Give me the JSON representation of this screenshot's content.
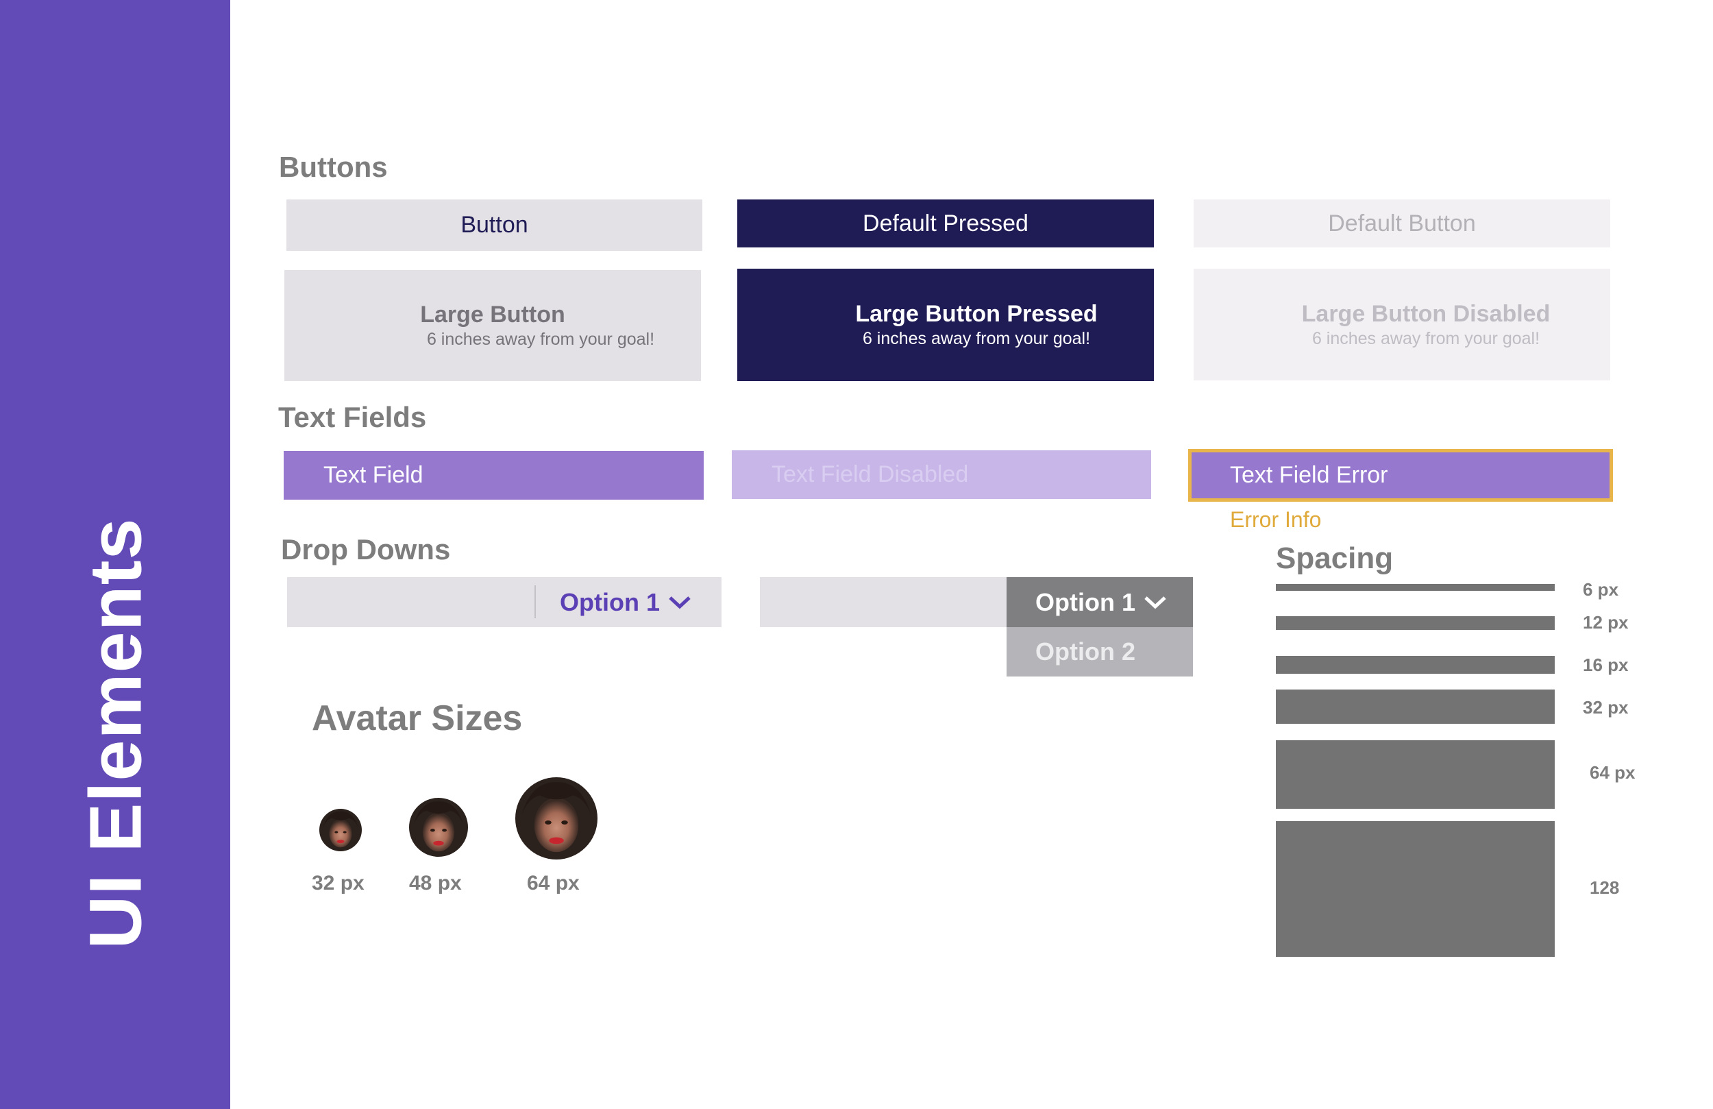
{
  "sidebar": {
    "title": "UI Elements",
    "color": "#624bb7"
  },
  "buttons": {
    "heading": "Buttons",
    "default": "Button",
    "pressed": "Default Pressed",
    "disabled": "Default Button",
    "large_default": {
      "title": "Large Button",
      "subtitle": "6 inches away from your goal!"
    },
    "large_pressed": {
      "title": "Large Button Pressed",
      "subtitle": "6 inches away from your goal!"
    },
    "large_disabled": {
      "title": "Large Button Disabled",
      "subtitle": "6 inches away from your goal!"
    }
  },
  "text_fields": {
    "heading": "Text Fields",
    "normal": "Text Field",
    "disabled": "Text Field Disabled",
    "error": "Text Field Error",
    "error_info": "Error Info"
  },
  "dropdowns": {
    "heading": "Drop Downs",
    "closed_selected": "Option 1",
    "open_selected": "Option 1",
    "open_options": [
      "Option 2"
    ]
  },
  "avatars": {
    "heading": "Avatar Sizes",
    "sizes": [
      "32 px",
      "48 px",
      "64 px"
    ]
  },
  "spacing": {
    "heading": "Spacing",
    "labels": [
      "6 px",
      "12 px",
      "16 px",
      "32 px",
      "64 px",
      "128"
    ]
  },
  "colors": {
    "primary": "#624bb7",
    "navy": "#1f1b55",
    "field": "#9679cf",
    "error": "#e8b54a"
  }
}
